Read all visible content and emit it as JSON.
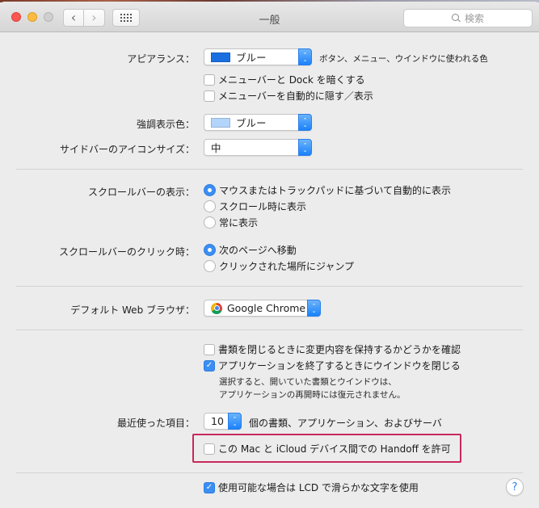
{
  "window": {
    "title": "一般",
    "search_placeholder": "検索",
    "back_glyph": "‹",
    "forward_glyph": "›"
  },
  "appearance": {
    "label": "アピアランス：",
    "value": "ブルー",
    "swatch_color": "#1a6fe0",
    "description": "ボタン、メニュー、ウインドウに使われる色",
    "checkboxes": [
      {
        "label": "メニューバーと Dock を暗くする",
        "checked": false
      },
      {
        "label": "メニューバーを自動的に隠す／表示",
        "checked": false
      }
    ]
  },
  "highlight": {
    "label": "強調表示色：",
    "value": "ブルー",
    "swatch_color": "#b3d4fb"
  },
  "sidebar_icon_size": {
    "label": "サイドバーのアイコンサイズ：",
    "value": "中"
  },
  "scrollbar_show": {
    "label": "スクロールバーの表示：",
    "options": [
      {
        "label": "マウスまたはトラックパッドに基づいて自動的に表示",
        "selected": true
      },
      {
        "label": "スクロール時に表示",
        "selected": false
      },
      {
        "label": "常に表示",
        "selected": false
      }
    ]
  },
  "scrollbar_click": {
    "label": "スクロールバーのクリック時：",
    "options": [
      {
        "label": "次のページへ移動",
        "selected": true
      },
      {
        "label": "クリックされた場所にジャンプ",
        "selected": false
      }
    ]
  },
  "browser": {
    "label": "デフォルト Web ブラウザ：",
    "value": "Google Chrome"
  },
  "documents": {
    "checkboxes": [
      {
        "label": "書類を閉じるときに変更内容を保持するかどうかを確認",
        "checked": false
      },
      {
        "label": "アプリケーションを終了するときにウインドウを閉じる",
        "checked": true
      }
    ],
    "note_line1": "選択すると、開いていた書類とウインドウは、",
    "note_line2": "アプリケーションの再開時には復元されません。"
  },
  "recent": {
    "label": "最近使った項目：",
    "value": "10",
    "suffix": "個の書類、アプリケーション、およびサーバ"
  },
  "handoff": {
    "label": "この Mac と iCloud デバイス間での Handoff を許可",
    "checked": false,
    "highlight_color": "#c8285c"
  },
  "lcd": {
    "label": "使用可能な場合は LCD で滑らかな文字を使用",
    "checked": true
  },
  "help": {
    "glyph": "?"
  },
  "colors": {
    "accent": "#3b8ef3"
  }
}
